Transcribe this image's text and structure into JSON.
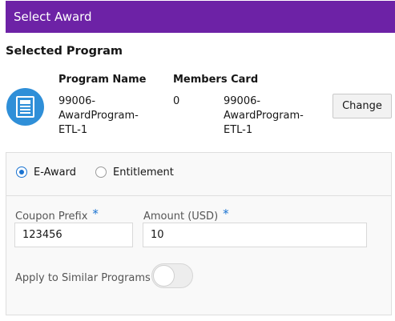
{
  "dialog": {
    "title": "Select Award"
  },
  "selected_program": {
    "heading": "Selected Program",
    "columns": {
      "program_name": "Program Name",
      "members_card": "Members Card"
    },
    "row": {
      "program_name_lines": [
        "99006-",
        "AwardProgram-",
        "ETL-1"
      ],
      "members_count": "0",
      "members_card_lines": [
        "99006-",
        "AwardProgram-",
        "ETL-1"
      ]
    },
    "change_label": "Change",
    "icon": "program-card-icon",
    "accent_color": "#2f8fd8"
  },
  "award_type": {
    "options": [
      {
        "label": "E-Award",
        "checked": true
      },
      {
        "label": "Entitlement",
        "checked": false
      }
    ]
  },
  "form": {
    "coupon_prefix": {
      "label": "Coupon Prefix",
      "required_mark": "*",
      "value": "123456"
    },
    "amount": {
      "label": "Amount (USD)",
      "required_mark": "*",
      "value": "10"
    },
    "apply_similar": {
      "label": "Apply to Similar Programs",
      "on": false
    }
  },
  "colors": {
    "header": "#6d22a6",
    "accent": "#1a73d1"
  }
}
